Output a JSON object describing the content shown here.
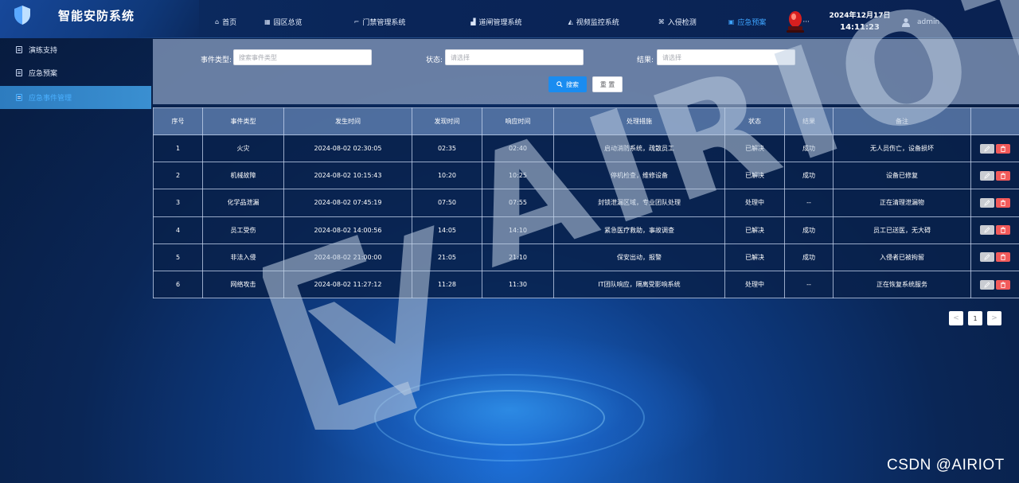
{
  "app": {
    "title": "智能安防系统"
  },
  "nav": {
    "items": [
      {
        "label": "首页",
        "icon": "home-icon",
        "active": false
      },
      {
        "label": "园区总览",
        "icon": "building-icon",
        "active": false
      },
      {
        "label": "门禁管理系统",
        "icon": "door-icon",
        "active": false
      },
      {
        "label": "道闸管理系统",
        "icon": "gate-icon",
        "active": false
      },
      {
        "label": "视频监控系统",
        "icon": "camera-icon",
        "active": false
      },
      {
        "label": "入侵检测",
        "icon": "intrusion-icon",
        "active": false
      },
      {
        "label": "应急预案",
        "icon": "plan-icon",
        "active": true
      },
      {
        "label": "···",
        "icon": "more-icon",
        "active": false
      }
    ]
  },
  "header": {
    "date": "2024年12月17日",
    "time": "14:11:23",
    "user": "admin",
    "icons": {
      "alarm": "alarm-light-icon",
      "user": "user-icon"
    }
  },
  "sidebar": {
    "items": [
      {
        "label": "演练支持",
        "active": false
      },
      {
        "label": "应急预案",
        "active": false
      },
      {
        "label": "应急事件管理",
        "active": true
      }
    ]
  },
  "filter": {
    "event_type_label": "事件类型:",
    "event_type_placeholder": "搜索事件类型",
    "status_label": "状态:",
    "status_placeholder": "请选择",
    "result_label": "结果:",
    "result_placeholder": "请选择",
    "search_button": "搜索",
    "reset_button": "重 置"
  },
  "table": {
    "columns": [
      "序号",
      "事件类型",
      "发生时间",
      "发现时间",
      "响应时间",
      "处理措施",
      "状态",
      "结果",
      "备注",
      ""
    ],
    "rows": [
      [
        "1",
        "火灾",
        "2024-08-02 02:30:05",
        "02:35",
        "02:40",
        "启动消防系统，疏散员工",
        "已解决",
        "成功",
        "无人员伤亡，设备损坏"
      ],
      [
        "2",
        "机械故障",
        "2024-08-02 10:15:43",
        "10:20",
        "10:25",
        "停机检查，维修设备",
        "已解决",
        "成功",
        "设备已修复"
      ],
      [
        "3",
        "化学品泄漏",
        "2024-08-02 07:45:19",
        "07:50",
        "07:55",
        "封锁泄漏区域，专业团队处理",
        "处理中",
        "--",
        "正在清理泄漏物"
      ],
      [
        "4",
        "员工受伤",
        "2024-08-02 14:00:56",
        "14:05",
        "14:10",
        "紧急医疗救助，事故调查",
        "已解决",
        "成功",
        "员工已送医，无大碍"
      ],
      [
        "5",
        "非法入侵",
        "2024-08-02 21:00:00",
        "21:05",
        "21:10",
        "保安出动，报警",
        "已解决",
        "成功",
        "入侵者已被拘留"
      ],
      [
        "6",
        "网络攻击",
        "2024-08-02 11:27:12",
        "11:28",
        "11:30",
        "IT团队响应，隔离受影响系统",
        "处理中",
        "--",
        "正在恢复系统服务"
      ]
    ]
  },
  "pagination": {
    "prev": "<",
    "current": "1",
    "next": ">"
  },
  "watermark": {
    "text": "AIRIOT"
  },
  "footer_watermark": "CSDN @AIRIOT",
  "colors": {
    "accent": "#1a8cf0",
    "active_text": "#3ea4ff",
    "delete": "#f25a5a"
  }
}
